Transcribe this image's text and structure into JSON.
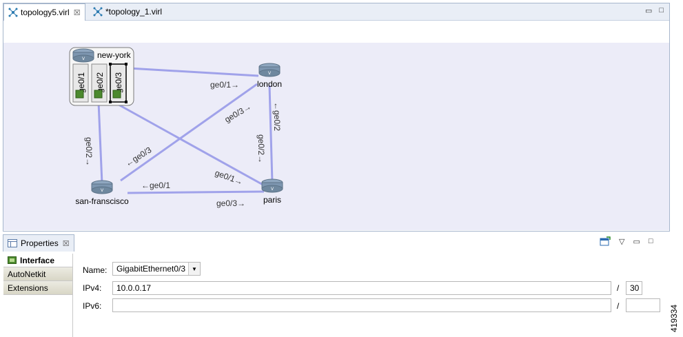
{
  "editor": {
    "tabs": [
      {
        "label": "topology5.virl",
        "active": true
      },
      {
        "label": "*topology_1.virl",
        "active": false
      }
    ]
  },
  "topology": {
    "nodes": [
      {
        "id": "new-york",
        "label": "new-york"
      },
      {
        "id": "london",
        "label": "london"
      },
      {
        "id": "san-francisco",
        "label": "san-franscisco"
      },
      {
        "id": "paris",
        "label": "paris"
      }
    ],
    "ny_interfaces": [
      "ge0/1",
      "ge0/2",
      "ge0/3"
    ],
    "link_labels": {
      "ny_london": "ge0/1→",
      "london_sf": "ge0/3→",
      "london_paris_top": "←ge0/2",
      "london_paris_bottom": "ge0/2→",
      "ny_sf": "ge0/2→",
      "sf_london": "←ge0/3",
      "sf_paris": "←ge0/1",
      "ny_paris": "ge0/1→",
      "paris_sf": "ge0/3→"
    },
    "link_color": "#9fa0e8"
  },
  "properties": {
    "title": "Properties",
    "sections": [
      "Interface",
      "AutoNetkit",
      "Extensions"
    ],
    "name_label": "Name:",
    "name_value": "GigabitEthernet0/3",
    "ipv4_label": "IPv4:",
    "ipv4_value": "10.0.0.17",
    "ipv4_prefix": "30",
    "ipv6_label": "IPv6:",
    "ipv6_value": "",
    "ipv6_prefix": "",
    "slash": "/"
  },
  "figure_id": "419334"
}
